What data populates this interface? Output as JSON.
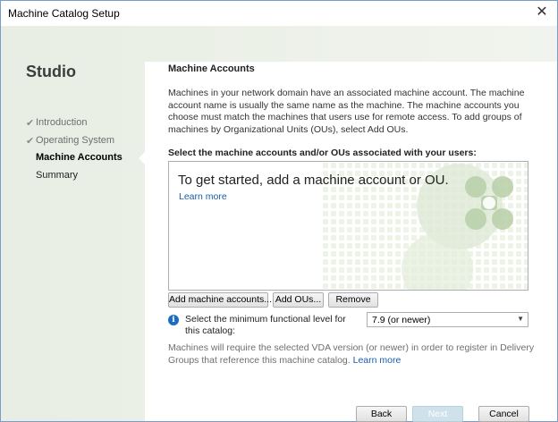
{
  "window": {
    "title": "Machine Catalog Setup",
    "close_glyph": "✕"
  },
  "sidebar": {
    "heading": "Studio",
    "steps": [
      {
        "label": "Introduction",
        "state": "done"
      },
      {
        "label": "Operating System",
        "state": "done"
      },
      {
        "label": "Machine Accounts",
        "state": "current"
      },
      {
        "label": "Summary",
        "state": "pending"
      }
    ],
    "check_glyph": "✔"
  },
  "main": {
    "section_title": "Machine Accounts",
    "description": "Machines in your network domain have an associated machine account. The machine account name is usually the same name as the machine. The machine accounts you choose must match the machines that users use for remote access. To add groups of machines by Organizational Units (OUs), select Add OUs.",
    "select_label": "Select the machine accounts and/or OUs associated with your users:",
    "list": {
      "prompt": "To get started, add a machine account or OU.",
      "learn_more": "Learn more"
    },
    "buttons": {
      "add_machine": "Add machine accounts...",
      "add_ou": "Add OUs...",
      "remove": "Remove"
    },
    "functional_level": {
      "label": "Select the minimum functional level for this catalog:",
      "selected": "7.9 (or newer)",
      "icon": "info-icon"
    },
    "note": {
      "text": "Machines will require the selected VDA version (or newer) in order to register in Delivery Groups that reference this machine catalog.",
      "link": "Learn more"
    }
  },
  "footer": {
    "back": "Back",
    "next": "Next",
    "cancel": "Cancel"
  },
  "colors": {
    "accent_link": "#1a5cab",
    "sidebar_bg": "#eef2ea",
    "watermark": "#9fbe8c",
    "next_disabled": "#cfe2ec"
  }
}
